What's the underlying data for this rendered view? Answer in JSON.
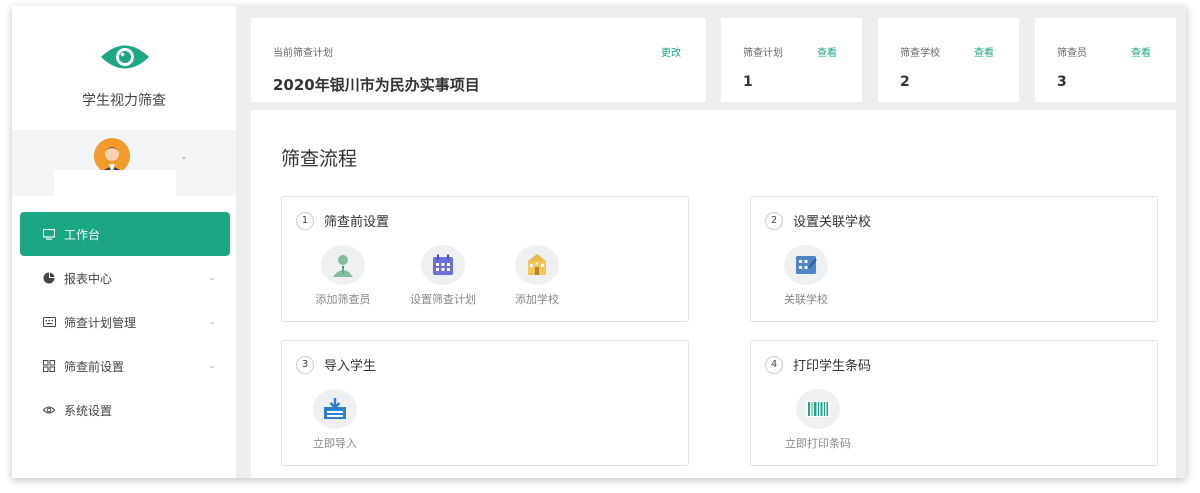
{
  "app": {
    "title": "学生视力筛查"
  },
  "menu": [
    {
      "label": "工作台",
      "icon": "monitor-icon",
      "active": true
    },
    {
      "label": "报表中心",
      "icon": "pie-chart-icon"
    },
    {
      "label": "筛查计划管理",
      "icon": "keyboard-icon"
    },
    {
      "label": "筛查前设置",
      "icon": "grid-icon"
    },
    {
      "label": "系统设置",
      "icon": "eye-settings-icon"
    }
  ],
  "plan": {
    "label": "当前筛查计划",
    "link": "更改",
    "value": "2020年银川市为民办实事项目"
  },
  "stats": [
    {
      "label": "筛查计划",
      "link": "查看",
      "value": "1"
    },
    {
      "label": "筛查学校",
      "link": "查看",
      "value": "2"
    },
    {
      "label": "筛查员",
      "link": "查看",
      "value": "3"
    }
  ],
  "main": {
    "title": "筛查流程",
    "steps": [
      {
        "num": "1",
        "title": "筛查前设置",
        "actions": [
          {
            "label": "添加筛查员",
            "icon": "user-icon"
          },
          {
            "label": "设置筛查计划",
            "icon": "calendar-icon"
          },
          {
            "label": "添加学校",
            "icon": "school-icon"
          }
        ]
      },
      {
        "num": "2",
        "title": "设置关联学校",
        "actions": [
          {
            "label": "关联学校",
            "icon": "link-school-icon"
          }
        ]
      },
      {
        "num": "3",
        "title": "导入学生",
        "actions": [
          {
            "label": "立即导入",
            "icon": "import-icon"
          }
        ]
      },
      {
        "num": "4",
        "title": "打印学生条码",
        "actions": [
          {
            "label": "立即打印条码",
            "icon": "barcode-icon"
          }
        ]
      }
    ]
  },
  "colors": {
    "accent": "#1ba784"
  }
}
